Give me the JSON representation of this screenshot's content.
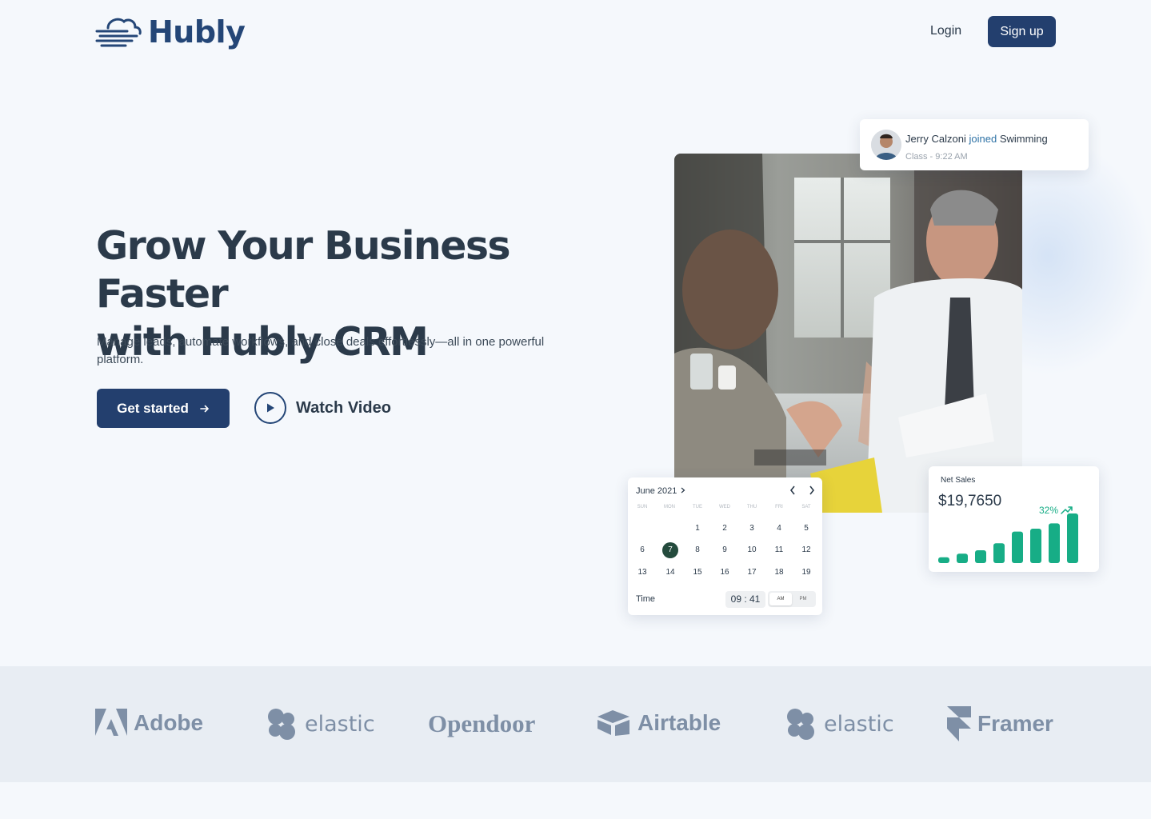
{
  "brand": {
    "name": "Hubly",
    "logo_icon": "cloud-wind-icon"
  },
  "nav": {
    "login": "Login",
    "signup": "Sign up"
  },
  "hero": {
    "title_line1": "Grow Your Business Faster",
    "title_line2": "with Hubly CRM",
    "subtitle": "Manage leads, automate workflows, and close deals effortlessly—all in one powerful platform.",
    "cta_primary": "Get started",
    "cta_secondary": "Watch Video"
  },
  "notification": {
    "name": "Jerry Calzoni",
    "action": "joined",
    "target": "Swimming",
    "meta": "Class -  9:22 AM"
  },
  "calendar": {
    "month": "June 2021",
    "weekdays": [
      "SUN",
      "MON",
      "TUE",
      "WED",
      "THU",
      "FRI",
      "SAT"
    ],
    "days": [
      "1",
      "2",
      "3",
      "4",
      "5",
      "6",
      "7",
      "8",
      "9",
      "10",
      "11",
      "12",
      "13",
      "14",
      "15",
      "16",
      "17",
      "18",
      "19"
    ],
    "selected_day": "7",
    "time_label": "Time",
    "time_value": "09 : 41",
    "am": "AM",
    "pm": "PM",
    "selected_period": "AM"
  },
  "sales": {
    "label": "Net Sales",
    "value": "$19,7650",
    "change": "32%",
    "bars": [
      1,
      1.6,
      2.2,
      3.4,
      5.4,
      5.9,
      6.8,
      8.5
    ],
    "color": "#17ad86"
  },
  "logos": [
    "Adobe",
    "elastic",
    "Opendoor",
    "Airtable",
    "elastic",
    "Framer"
  ],
  "colors": {
    "primary": "#233f6e",
    "brand_text": "#244677",
    "accent_green": "#17ad86",
    "logo_gray": "#7e8fa6"
  }
}
